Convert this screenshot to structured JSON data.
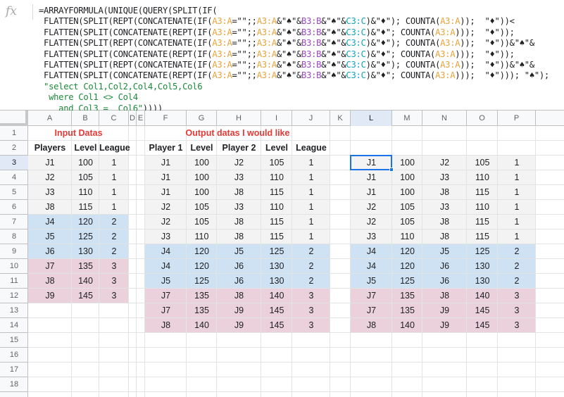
{
  "formula": {
    "fx_symbol": "fx",
    "lines": [
      [
        [
          "t",
          "=ARRAYFORMULA(UNIQUE(QUERY(SPLIT(IF("
        ]
      ],
      [
        [
          "t",
          " FLATTEN(SPLIT(REPT(CONCATENATE(IF("
        ],
        [
          "o",
          "A3:A"
        ],
        [
          "t",
          "=\"\";;"
        ],
        [
          "o",
          "A3:A"
        ],
        [
          "t",
          "&\"♠\"&"
        ],
        [
          "p",
          "B3:B"
        ],
        [
          "t",
          "&\"♠\"&"
        ],
        [
          "c",
          "C3:C"
        ],
        [
          "t",
          ")&\"♦\"); COUNTA("
        ],
        [
          "o",
          "A3:A"
        ],
        [
          "t",
          "));  \"♦\"))<"
        ]
      ],
      [
        [
          "t",
          " FLATTEN(SPLIT(CONCATENATE(REPT(IF("
        ],
        [
          "o",
          "A3:A"
        ],
        [
          "t",
          "=\"\";;"
        ],
        [
          "o",
          "A3:A"
        ],
        [
          "t",
          "&\"♠\"&"
        ],
        [
          "p",
          "B3:B"
        ],
        [
          "t",
          "&\"♠\"&"
        ],
        [
          "c",
          "C3:C"
        ],
        [
          "t",
          ")&\"♦\"; COUNTA("
        ],
        [
          "o",
          "A3:A"
        ],
        [
          "t",
          ")));  \"♦\"));"
        ]
      ],
      [
        [
          "t",
          " FLATTEN(SPLIT(REPT(CONCATENATE(IF("
        ],
        [
          "o",
          "A3:A"
        ],
        [
          "t",
          "=\"\";;"
        ],
        [
          "o",
          "A3:A"
        ],
        [
          "t",
          "&\"♠\"&"
        ],
        [
          "p",
          "B3:B"
        ],
        [
          "t",
          "&\"♠\"&"
        ],
        [
          "c",
          "C3:C"
        ],
        [
          "t",
          ")&\"♦\"); COUNTA("
        ],
        [
          "o",
          "A3:A"
        ],
        [
          "t",
          "));  \"♦\"))&\"♠\"&"
        ]
      ],
      [
        [
          "t",
          " FLATTEN(SPLIT(CONCATENATE(REPT(IF("
        ],
        [
          "o",
          "A3:A"
        ],
        [
          "t",
          "=\"\";;"
        ],
        [
          "o",
          "A3:A"
        ],
        [
          "t",
          "&\"♠\"&"
        ],
        [
          "p",
          "B3:B"
        ],
        [
          "t",
          "&\"♠\"&"
        ],
        [
          "c",
          "C3:C"
        ],
        [
          "t",
          ")&\"♦\"; COUNTA("
        ],
        [
          "o",
          "A3:A"
        ],
        [
          "t",
          ")));  \"♦\"));"
        ]
      ],
      [
        [
          "t",
          " FLATTEN(SPLIT(REPT(CONCATENATE(IF("
        ],
        [
          "o",
          "A3:A"
        ],
        [
          "t",
          "=\"\";;"
        ],
        [
          "o",
          "A3:A"
        ],
        [
          "t",
          "&\"♠\"&"
        ],
        [
          "p",
          "B3:B"
        ],
        [
          "t",
          "&\"♠\"&"
        ],
        [
          "c",
          "C3:C"
        ],
        [
          "t",
          ")&\"♦\"); COUNTA("
        ],
        [
          "o",
          "A3:A"
        ],
        [
          "t",
          "));  \"♦\"))&\"♠\"&"
        ]
      ],
      [
        [
          "t",
          " FLATTEN(SPLIT(CONCATENATE(REPT(IF("
        ],
        [
          "o",
          "A3:A"
        ],
        [
          "t",
          "=\"\";;"
        ],
        [
          "o",
          "A3:A"
        ],
        [
          "t",
          "&\"♠\"&"
        ],
        [
          "p",
          "B3:B"
        ],
        [
          "t",
          "&\"♠\"&"
        ],
        [
          "c",
          "C3:C"
        ],
        [
          "t",
          ")&\"♦\"; COUNTA("
        ],
        [
          "o",
          "A3:A"
        ],
        [
          "t",
          ")));  \"♦\"))); \"♠\");"
        ]
      ],
      [
        [
          "s",
          " \"select Col1,Col2,Col4,Col5,Col6"
        ]
      ],
      [
        [
          "s",
          "  where Col1 <> Col4"
        ]
      ],
      [
        [
          "s",
          "    and Col3 =  Col6\""
        ],
        [
          "t",
          "))))"
        ]
      ]
    ]
  },
  "columns": [
    "A",
    "B",
    "C",
    "D",
    "E",
    "F",
    "G",
    "H",
    "I",
    "J",
    "K",
    "L",
    "M",
    "N",
    "O",
    "P"
  ],
  "selected_column": "L",
  "rows": [
    "1",
    "2",
    "3",
    "4",
    "5",
    "6",
    "7",
    "8",
    "9",
    "10",
    "11",
    "12",
    "13",
    "14",
    "15",
    "16",
    "17",
    "18"
  ],
  "selected_row": "3",
  "titles": {
    "input": "Input Datas",
    "output": "Output datas I would like"
  },
  "input_headers": [
    "Players",
    "Level",
    "League"
  ],
  "output_headers": [
    "Player 1",
    "Level",
    "Player 2",
    "Level",
    "League"
  ],
  "input_rows": [
    {
      "p": "J1",
      "lvl": "100",
      "lg": "1",
      "group": "gray"
    },
    {
      "p": "J2",
      "lvl": "105",
      "lg": "1",
      "group": "gray"
    },
    {
      "p": "J3",
      "lvl": "110",
      "lg": "1",
      "group": "gray"
    },
    {
      "p": "J8",
      "lvl": "115",
      "lg": "1",
      "group": "gray"
    },
    {
      "p": "J4",
      "lvl": "120",
      "lg": "2",
      "group": "blue"
    },
    {
      "p": "J5",
      "lvl": "125",
      "lg": "2",
      "group": "blue"
    },
    {
      "p": "J6",
      "lvl": "130",
      "lg": "2",
      "group": "blue"
    },
    {
      "p": "J7",
      "lvl": "135",
      "lg": "3",
      "group": "pink"
    },
    {
      "p": "J8",
      "lvl": "140",
      "lg": "3",
      "group": "pink"
    },
    {
      "p": "J9",
      "lvl": "145",
      "lg": "3",
      "group": "pink"
    }
  ],
  "output_rows": [
    {
      "p1": "J1",
      "l1": "100",
      "p2": "J2",
      "l2": "105",
      "lg": "1",
      "group": "gray"
    },
    {
      "p1": "J1",
      "l1": "100",
      "p2": "J3",
      "l2": "110",
      "lg": "1",
      "group": "gray"
    },
    {
      "p1": "J1",
      "l1": "100",
      "p2": "J8",
      "l2": "115",
      "lg": "1",
      "group": "gray"
    },
    {
      "p1": "J2",
      "l1": "105",
      "p2": "J3",
      "l2": "110",
      "lg": "1",
      "group": "gray"
    },
    {
      "p1": "J2",
      "l1": "105",
      "p2": "J8",
      "l2": "115",
      "lg": "1",
      "group": "gray"
    },
    {
      "p1": "J3",
      "l1": "110",
      "p2": "J8",
      "l2": "115",
      "lg": "1",
      "group": "gray"
    },
    {
      "p1": "J4",
      "l1": "120",
      "p2": "J5",
      "l2": "125",
      "lg": "2",
      "group": "blue"
    },
    {
      "p1": "J4",
      "l1": "120",
      "p2": "J6",
      "l2": "130",
      "lg": "2",
      "group": "blue"
    },
    {
      "p1": "J5",
      "l1": "125",
      "p2": "J6",
      "l2": "130",
      "lg": "2",
      "group": "blue"
    },
    {
      "p1": "J7",
      "l1": "135",
      "p2": "J8",
      "l2": "140",
      "lg": "3",
      "group": "pink"
    },
    {
      "p1": "J7",
      "l1": "135",
      "p2": "J9",
      "l2": "145",
      "lg": "3",
      "group": "pink"
    },
    {
      "p1": "J8",
      "l1": "140",
      "p2": "J9",
      "l2": "145",
      "lg": "3",
      "group": "pink"
    }
  ],
  "result_rows": [
    {
      "p1": "J1",
      "l1": "100",
      "p2": "J2",
      "l2": "105",
      "lg": "1",
      "group": "gray"
    },
    {
      "p1": "J1",
      "l1": "100",
      "p2": "J3",
      "l2": "110",
      "lg": "1",
      "group": "gray"
    },
    {
      "p1": "J1",
      "l1": "100",
      "p2": "J8",
      "l2": "115",
      "lg": "1",
      "group": "gray"
    },
    {
      "p1": "J2",
      "l1": "105",
      "p2": "J3",
      "l2": "110",
      "lg": "1",
      "group": "gray"
    },
    {
      "p1": "J2",
      "l1": "105",
      "p2": "J8",
      "l2": "115",
      "lg": "1",
      "group": "gray"
    },
    {
      "p1": "J3",
      "l1": "110",
      "p2": "J8",
      "l2": "115",
      "lg": "1",
      "group": "gray"
    },
    {
      "p1": "J4",
      "l1": "120",
      "p2": "J5",
      "l2": "125",
      "lg": "2",
      "group": "blue"
    },
    {
      "p1": "J4",
      "l1": "120",
      "p2": "J6",
      "l2": "130",
      "lg": "2",
      "group": "blue"
    },
    {
      "p1": "J5",
      "l1": "125",
      "p2": "J6",
      "l2": "130",
      "lg": "2",
      "group": "blue"
    },
    {
      "p1": "J7",
      "l1": "135",
      "p2": "J8",
      "l2": "140",
      "lg": "3",
      "group": "pink"
    },
    {
      "p1": "J7",
      "l1": "135",
      "p2": "J9",
      "l2": "145",
      "lg": "3",
      "group": "pink"
    },
    {
      "p1": "J8",
      "l1": "140",
      "p2": "J9",
      "l2": "145",
      "lg": "3",
      "group": "pink"
    }
  ],
  "colors": {
    "gray": "#f3f3f3",
    "blue": "#cfe2f3",
    "pink": "#ead1dc",
    "title_red": "#e53935",
    "selection": "#1a73e8"
  }
}
